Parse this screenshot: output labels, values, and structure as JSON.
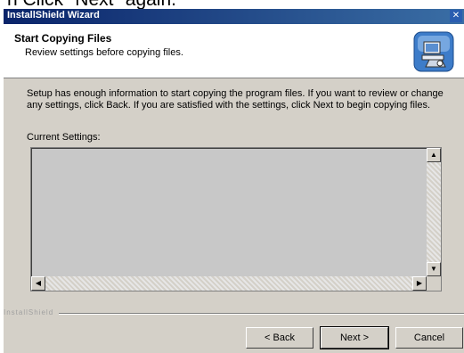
{
  "caption": "n Click \"Next\" again.",
  "window": {
    "title": "InstallShield Wizard",
    "close_glyph": "✕"
  },
  "header": {
    "title": "Start Copying Files",
    "subtitle": "Review settings before copying files.",
    "logo_icon": "installshield-computer-icon"
  },
  "body": {
    "intro": "Setup has enough information to start copying the program files. If you want to review or change any settings, click Back. If you are satisfied with the settings, click Next to begin copying files.",
    "current_settings_label": "Current Settings:",
    "current_settings_value": ""
  },
  "scroll": {
    "up": "▲",
    "down": "▼",
    "left": "◀",
    "right": "▶"
  },
  "footer": {
    "brand": "InstallShield",
    "back_label": "< Back",
    "next_label": "Next >",
    "cancel_label": "Cancel"
  },
  "colors": {
    "dialog_bg": "#d4d0c8",
    "titlebar": "#0a246a",
    "header_bg": "#ffffff"
  }
}
